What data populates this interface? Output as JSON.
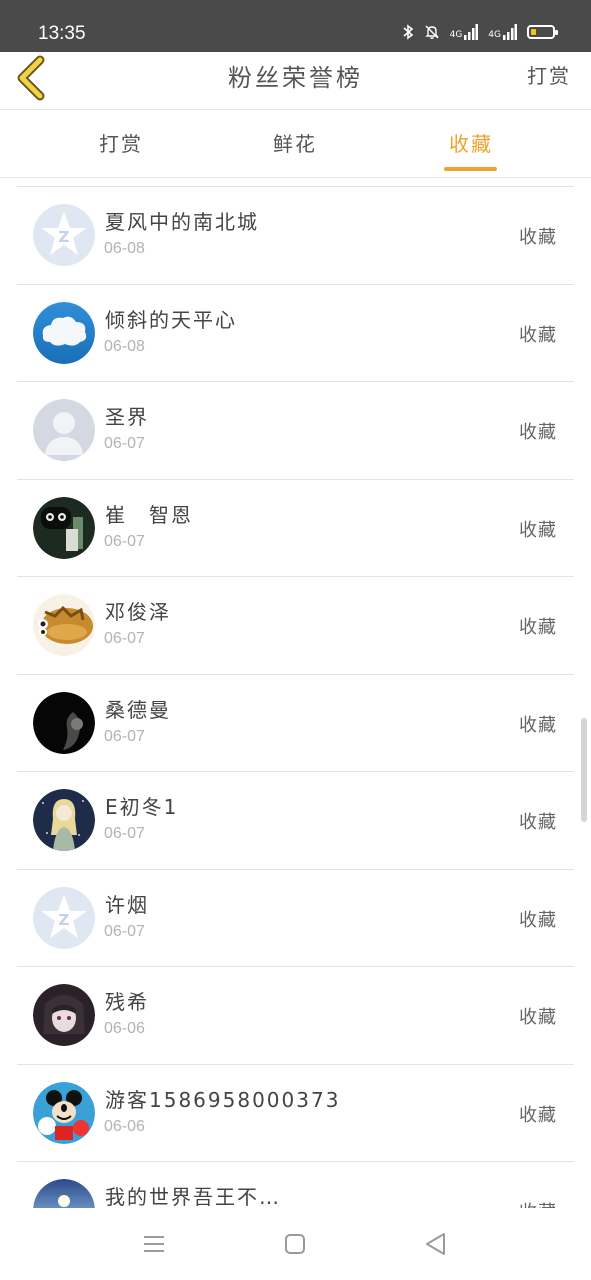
{
  "status_bar": {
    "time": "13:35",
    "icons": [
      "bluetooth-icon",
      "bell-off-icon",
      "signal-4g-icon",
      "signal-4g-icon",
      "battery-icon"
    ],
    "network_labels": [
      "4G",
      "4G"
    ]
  },
  "header": {
    "title": "粉丝荣誉榜",
    "action_label": "打赏",
    "back_icon": "chevron-left-icon",
    "accent_color": "#f0a22c"
  },
  "tabs": [
    {
      "label": "打赏",
      "active": false
    },
    {
      "label": "鲜花",
      "active": false
    },
    {
      "label": "收藏",
      "active": true
    }
  ],
  "fans": [
    {
      "name": "夏风中的南北城",
      "date": "06-08",
      "action": "收藏",
      "avatar": "default-qq-avatar"
    },
    {
      "name": "倾斜的天平心",
      "date": "06-08",
      "action": "收藏",
      "avatar": "cloud-avatar"
    },
    {
      "name": "圣界",
      "date": "06-07",
      "action": "收藏",
      "avatar": "default-person-avatar"
    },
    {
      "name": "崔　智恩",
      "date": "06-07",
      "action": "收藏",
      "avatar": "robot-photo-avatar"
    },
    {
      "name": "邓俊泽",
      "date": "06-07",
      "action": "收藏",
      "avatar": "fish-avatar"
    },
    {
      "name": "桑德曼",
      "date": "06-07",
      "action": "收藏",
      "avatar": "dark-photo-avatar"
    },
    {
      "name": "E初冬1",
      "date": "06-07",
      "action": "收藏",
      "avatar": "anime-girl-avatar"
    },
    {
      "name": "许烟",
      "date": "06-07",
      "action": "收藏",
      "avatar": "default-qq-avatar"
    },
    {
      "name": "残希",
      "date": "06-06",
      "action": "收藏",
      "avatar": "anime-dark-avatar"
    },
    {
      "name": "游客1586958000373",
      "date": "06-06",
      "action": "收藏",
      "avatar": "mickey-avatar"
    },
    {
      "name": "我的世界吾王不…",
      "date": "",
      "action": "收藏",
      "avatar": "sky-avatar"
    }
  ],
  "navbar": {
    "icons": [
      "menu-icon",
      "home-square-icon",
      "back-triangle-icon"
    ]
  }
}
